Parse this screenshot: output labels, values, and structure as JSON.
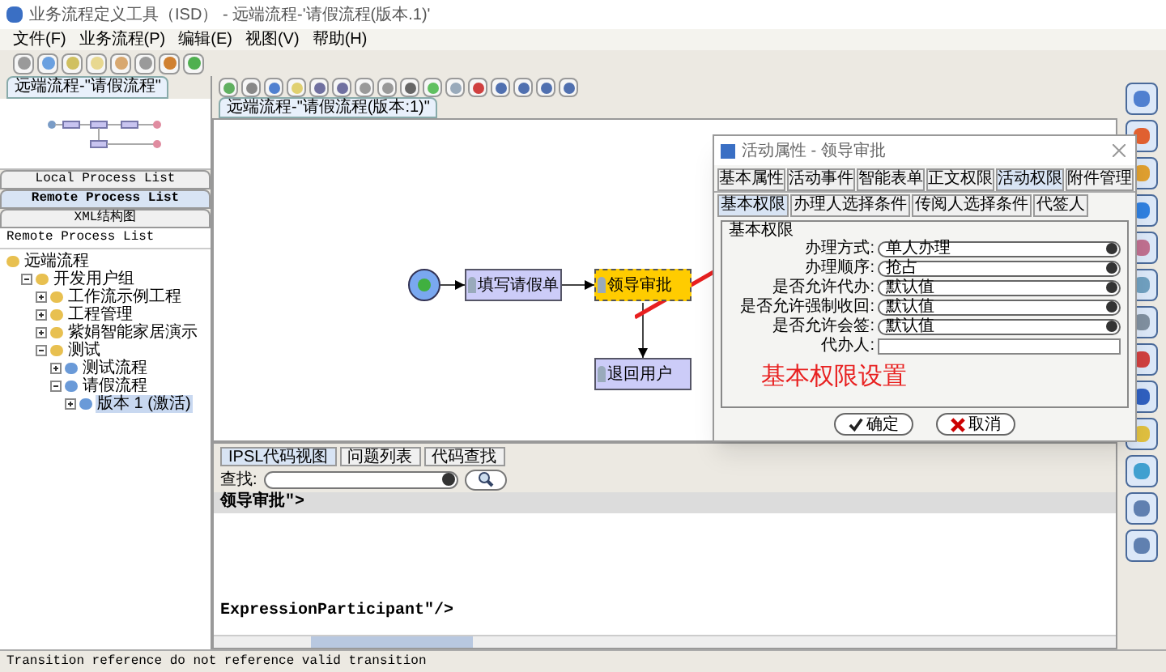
{
  "window": {
    "title": "业务流程定义工具（ISD）  - 远端流程-'请假流程(版本.1)'"
  },
  "menu": [
    "文件(F)",
    "业务流程(P)",
    "编辑(E)",
    "视图(V)",
    "帮助(H)"
  ],
  "left_panel": {
    "tab": "远端流程-\"请假流程\"",
    "list_tabs": [
      {
        "label": "Local Process List",
        "selected": false
      },
      {
        "label": "Remote Process List",
        "selected": true
      },
      {
        "label": "XML结构图",
        "selected": false
      }
    ],
    "tree_header": "Remote Process List",
    "tree": [
      {
        "label": "远端流程",
        "selected": false,
        "children": [
          {
            "label": "开发用户组",
            "expanded": true,
            "selected": false,
            "children": [
              {
                "label": "工作流示例工程",
                "expanded": false,
                "selected": false
              },
              {
                "label": "工程管理",
                "expanded": false,
                "selected": false
              },
              {
                "label": "紫娟智能家居演示",
                "expanded": false,
                "selected": false
              },
              {
                "label": "测试",
                "expanded": true,
                "selected": false,
                "children": [
                  {
                    "label": "测试流程",
                    "expanded": false,
                    "selected": false
                  },
                  {
                    "label": "请假流程",
                    "expanded": true,
                    "selected": false,
                    "children": [
                      {
                        "label": "版本 1 (激活)",
                        "expanded": false,
                        "selected": true
                      }
                    ]
                  }
                ]
              }
            ]
          }
        ]
      }
    ]
  },
  "editor_tab": "远端流程-\"请假流程(版本:1)\"",
  "diagram": {
    "nodes": [
      {
        "kind": "start"
      },
      {
        "kind": "activity",
        "label": "填写请假单",
        "selected": false
      },
      {
        "kind": "activity",
        "label": "领导审批",
        "selected": true
      },
      {
        "kind": "activity",
        "label": "退回用户",
        "selected": false
      }
    ]
  },
  "annotation": "基本权限设置",
  "dialog": {
    "title": "活动属性 - 领导审批",
    "tabs": [
      {
        "label": "基本属性",
        "selected": false
      },
      {
        "label": "活动事件",
        "selected": false
      },
      {
        "label": "智能表单",
        "selected": false
      },
      {
        "label": "正文权限",
        "selected": false
      },
      {
        "label": "活动权限",
        "selected": true
      },
      {
        "label": "附件管理",
        "selected": false
      }
    ],
    "subtabs": [
      {
        "label": "基本权限",
        "selected": true
      },
      {
        "label": "办理人选择条件",
        "selected": false
      },
      {
        "label": "传阅人选择条件",
        "selected": false
      },
      {
        "label": "代签人",
        "selected": false
      }
    ],
    "group": "基本权限",
    "fields": [
      {
        "kind": "select",
        "label": "办理方式:",
        "value": "单人办理"
      },
      {
        "kind": "select",
        "label": "办理顺序:",
        "value": "抢占"
      },
      {
        "kind": "select",
        "label": "是否允许代办:",
        "value": "默认值"
      },
      {
        "kind": "select",
        "label": "是否允许强制收回:",
        "value": "默认值"
      },
      {
        "kind": "select",
        "label": "是否允许会签:",
        "value": "默认值"
      },
      {
        "kind": "text",
        "label": "代办人:"
      }
    ],
    "buttons": [
      "确定",
      "取消"
    ]
  },
  "bottom": {
    "tabs": [
      {
        "label": "IPSL代码视图",
        "selected": true
      },
      {
        "label": "问题列表",
        "selected": false
      },
      {
        "label": "代码查找",
        "selected": false
      }
    ],
    "search_label": "查找:",
    "code": [
      {
        "text": "领导审批\">",
        "highlighted": true
      },
      {
        "text": "ExpressionParticipant\"/>",
        "highlighted": false
      }
    ]
  },
  "status_bar": "Transition reference do not reference valid transition"
}
